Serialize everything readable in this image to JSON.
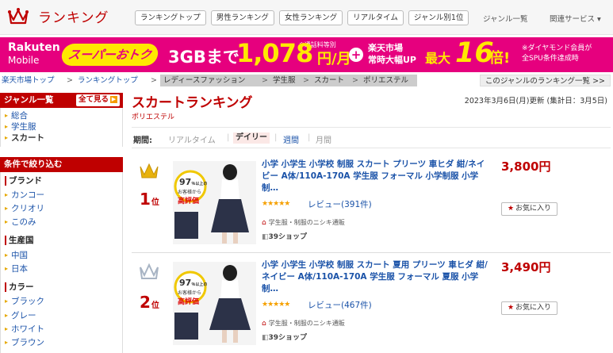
{
  "header": {
    "logo_text": "ランキング",
    "top_links": [
      "ランキングトップ",
      "男性ランキング",
      "女性ランキング",
      "リアルタイム",
      "ジャンル別1位"
    ],
    "genre_list": "ジャンル一覧",
    "related": "関連サービス ▾"
  },
  "banner": {
    "brand1": "Rakuten",
    "brand2": "Mobile",
    "super": "スーパーおトク",
    "gb": "3GBまで",
    "price": "1,078",
    "yen": "円/月",
    "note": "※通話料等別",
    "plus": "+",
    "market1": "楽天市場",
    "market2": "常時大幅UP",
    "max": "最大",
    "times": "16",
    "bai": "倍!",
    "dia1": "※ダイヤモンド会員が",
    "dia2": "全SPU条件達成時"
  },
  "breadcrumb": {
    "items": [
      "楽天市場トップ",
      "ランキングトップ",
      "レディースファッション",
      "学生服",
      "スカート",
      "ポリエステル"
    ],
    "sep": ">",
    "right_link": "このジャンルのランキング一覧 >>"
  },
  "sidebar": {
    "genre_title": "ジャンル一覧",
    "show_all": "全て見る",
    "genres": [
      "総合",
      "学生服",
      "スカート"
    ],
    "filter_title": "条件で絞り込む",
    "brand_title": "ブランド",
    "brands": [
      "カンコー",
      "クリオリ",
      "このみ"
    ],
    "country_title": "生産国",
    "countries": [
      "中国",
      "日本"
    ],
    "color_title": "カラー",
    "colors": [
      "ブラック",
      "グレー",
      "ホワイト",
      "ブラウン"
    ]
  },
  "main": {
    "title": "スカートランキング",
    "subtitle": "ポリエステル",
    "updated": "2023年3月6日(月)更新 (集計日：3月5日)",
    "period_label": "期間:",
    "periods": [
      "リアルタイム",
      "デイリー",
      "週間",
      "月間"
    ]
  },
  "items": [
    {
      "rank": "1",
      "rank_suffix": "位",
      "title": "小学 小学生 小学校 制服 スカート プリーツ 車ヒダ 紺/ネイビー A体/110A-170A 学生服 フォーマル 小学制服 小学制…",
      "stars": "★★★★★",
      "review": "レビュー(391件)",
      "shop": "学生服・制服のニシキ通販",
      "shop_badge": "39ショップ",
      "price": "3,800円",
      "fav": "お気に入り",
      "thumb_tag1": "97",
      "thumb_tag2": "％以上の",
      "thumb_tag3": "お客様から",
      "thumb_tag4": "高評価",
      "crown_color": "#e8b20c"
    },
    {
      "rank": "2",
      "rank_suffix": "位",
      "title": "小学 小学生 小学校 制服 スカート 夏用 プリーツ 車ヒダ 紺/ネイビー A体/110A-170A 学生服 フォーマル 夏服 小学制…",
      "stars": "★★★★★",
      "review": "レビュー(467件)",
      "shop": "学生服・制服のニシキ通販",
      "shop_badge": "39ショップ",
      "price": "3,490円",
      "fav": "お気に入り",
      "thumb_tag1": "97",
      "thumb_tag2": "％以上の",
      "thumb_tag3": "お客様から",
      "thumb_tag4": "高評価",
      "crown_color": "#a8b4c4"
    }
  ],
  "colors": {
    "accent": "#bf0000",
    "link": "#1a52a8",
    "banner": "#e6007e",
    "banner_yellow": "#ffe800"
  }
}
